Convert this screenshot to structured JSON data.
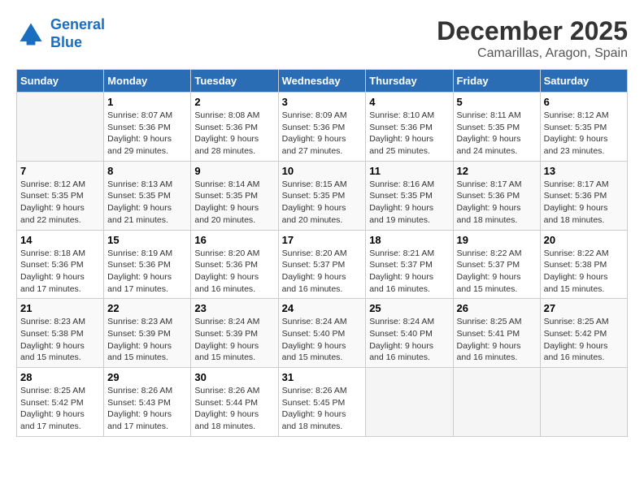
{
  "header": {
    "logo_line1": "General",
    "logo_line2": "Blue",
    "month": "December 2025",
    "location": "Camarillas, Aragon, Spain"
  },
  "weekdays": [
    "Sunday",
    "Monday",
    "Tuesday",
    "Wednesday",
    "Thursday",
    "Friday",
    "Saturday"
  ],
  "weeks": [
    [
      {
        "num": "",
        "sunrise": "",
        "sunset": "",
        "daylight": ""
      },
      {
        "num": "1",
        "sunrise": "Sunrise: 8:07 AM",
        "sunset": "Sunset: 5:36 PM",
        "daylight": "Daylight: 9 hours and 29 minutes."
      },
      {
        "num": "2",
        "sunrise": "Sunrise: 8:08 AM",
        "sunset": "Sunset: 5:36 PM",
        "daylight": "Daylight: 9 hours and 28 minutes."
      },
      {
        "num": "3",
        "sunrise": "Sunrise: 8:09 AM",
        "sunset": "Sunset: 5:36 PM",
        "daylight": "Daylight: 9 hours and 27 minutes."
      },
      {
        "num": "4",
        "sunrise": "Sunrise: 8:10 AM",
        "sunset": "Sunset: 5:36 PM",
        "daylight": "Daylight: 9 hours and 25 minutes."
      },
      {
        "num": "5",
        "sunrise": "Sunrise: 8:11 AM",
        "sunset": "Sunset: 5:35 PM",
        "daylight": "Daylight: 9 hours and 24 minutes."
      },
      {
        "num": "6",
        "sunrise": "Sunrise: 8:12 AM",
        "sunset": "Sunset: 5:35 PM",
        "daylight": "Daylight: 9 hours and 23 minutes."
      }
    ],
    [
      {
        "num": "7",
        "sunrise": "Sunrise: 8:12 AM",
        "sunset": "Sunset: 5:35 PM",
        "daylight": "Daylight: 9 hours and 22 minutes."
      },
      {
        "num": "8",
        "sunrise": "Sunrise: 8:13 AM",
        "sunset": "Sunset: 5:35 PM",
        "daylight": "Daylight: 9 hours and 21 minutes."
      },
      {
        "num": "9",
        "sunrise": "Sunrise: 8:14 AM",
        "sunset": "Sunset: 5:35 PM",
        "daylight": "Daylight: 9 hours and 20 minutes."
      },
      {
        "num": "10",
        "sunrise": "Sunrise: 8:15 AM",
        "sunset": "Sunset: 5:35 PM",
        "daylight": "Daylight: 9 hours and 20 minutes."
      },
      {
        "num": "11",
        "sunrise": "Sunrise: 8:16 AM",
        "sunset": "Sunset: 5:35 PM",
        "daylight": "Daylight: 9 hours and 19 minutes."
      },
      {
        "num": "12",
        "sunrise": "Sunrise: 8:17 AM",
        "sunset": "Sunset: 5:36 PM",
        "daylight": "Daylight: 9 hours and 18 minutes."
      },
      {
        "num": "13",
        "sunrise": "Sunrise: 8:17 AM",
        "sunset": "Sunset: 5:36 PM",
        "daylight": "Daylight: 9 hours and 18 minutes."
      }
    ],
    [
      {
        "num": "14",
        "sunrise": "Sunrise: 8:18 AM",
        "sunset": "Sunset: 5:36 PM",
        "daylight": "Daylight: 9 hours and 17 minutes."
      },
      {
        "num": "15",
        "sunrise": "Sunrise: 8:19 AM",
        "sunset": "Sunset: 5:36 PM",
        "daylight": "Daylight: 9 hours and 17 minutes."
      },
      {
        "num": "16",
        "sunrise": "Sunrise: 8:20 AM",
        "sunset": "Sunset: 5:36 PM",
        "daylight": "Daylight: 9 hours and 16 minutes."
      },
      {
        "num": "17",
        "sunrise": "Sunrise: 8:20 AM",
        "sunset": "Sunset: 5:37 PM",
        "daylight": "Daylight: 9 hours and 16 minutes."
      },
      {
        "num": "18",
        "sunrise": "Sunrise: 8:21 AM",
        "sunset": "Sunset: 5:37 PM",
        "daylight": "Daylight: 9 hours and 16 minutes."
      },
      {
        "num": "19",
        "sunrise": "Sunrise: 8:22 AM",
        "sunset": "Sunset: 5:37 PM",
        "daylight": "Daylight: 9 hours and 15 minutes."
      },
      {
        "num": "20",
        "sunrise": "Sunrise: 8:22 AM",
        "sunset": "Sunset: 5:38 PM",
        "daylight": "Daylight: 9 hours and 15 minutes."
      }
    ],
    [
      {
        "num": "21",
        "sunrise": "Sunrise: 8:23 AM",
        "sunset": "Sunset: 5:38 PM",
        "daylight": "Daylight: 9 hours and 15 minutes."
      },
      {
        "num": "22",
        "sunrise": "Sunrise: 8:23 AM",
        "sunset": "Sunset: 5:39 PM",
        "daylight": "Daylight: 9 hours and 15 minutes."
      },
      {
        "num": "23",
        "sunrise": "Sunrise: 8:24 AM",
        "sunset": "Sunset: 5:39 PM",
        "daylight": "Daylight: 9 hours and 15 minutes."
      },
      {
        "num": "24",
        "sunrise": "Sunrise: 8:24 AM",
        "sunset": "Sunset: 5:40 PM",
        "daylight": "Daylight: 9 hours and 15 minutes."
      },
      {
        "num": "25",
        "sunrise": "Sunrise: 8:24 AM",
        "sunset": "Sunset: 5:40 PM",
        "daylight": "Daylight: 9 hours and 16 minutes."
      },
      {
        "num": "26",
        "sunrise": "Sunrise: 8:25 AM",
        "sunset": "Sunset: 5:41 PM",
        "daylight": "Daylight: 9 hours and 16 minutes."
      },
      {
        "num": "27",
        "sunrise": "Sunrise: 8:25 AM",
        "sunset": "Sunset: 5:42 PM",
        "daylight": "Daylight: 9 hours and 16 minutes."
      }
    ],
    [
      {
        "num": "28",
        "sunrise": "Sunrise: 8:25 AM",
        "sunset": "Sunset: 5:42 PM",
        "daylight": "Daylight: 9 hours and 17 minutes."
      },
      {
        "num": "29",
        "sunrise": "Sunrise: 8:26 AM",
        "sunset": "Sunset: 5:43 PM",
        "daylight": "Daylight: 9 hours and 17 minutes."
      },
      {
        "num": "30",
        "sunrise": "Sunrise: 8:26 AM",
        "sunset": "Sunset: 5:44 PM",
        "daylight": "Daylight: 9 hours and 18 minutes."
      },
      {
        "num": "31",
        "sunrise": "Sunrise: 8:26 AM",
        "sunset": "Sunset: 5:45 PM",
        "daylight": "Daylight: 9 hours and 18 minutes."
      },
      {
        "num": "",
        "sunrise": "",
        "sunset": "",
        "daylight": ""
      },
      {
        "num": "",
        "sunrise": "",
        "sunset": "",
        "daylight": ""
      },
      {
        "num": "",
        "sunrise": "",
        "sunset": "",
        "daylight": ""
      }
    ]
  ]
}
